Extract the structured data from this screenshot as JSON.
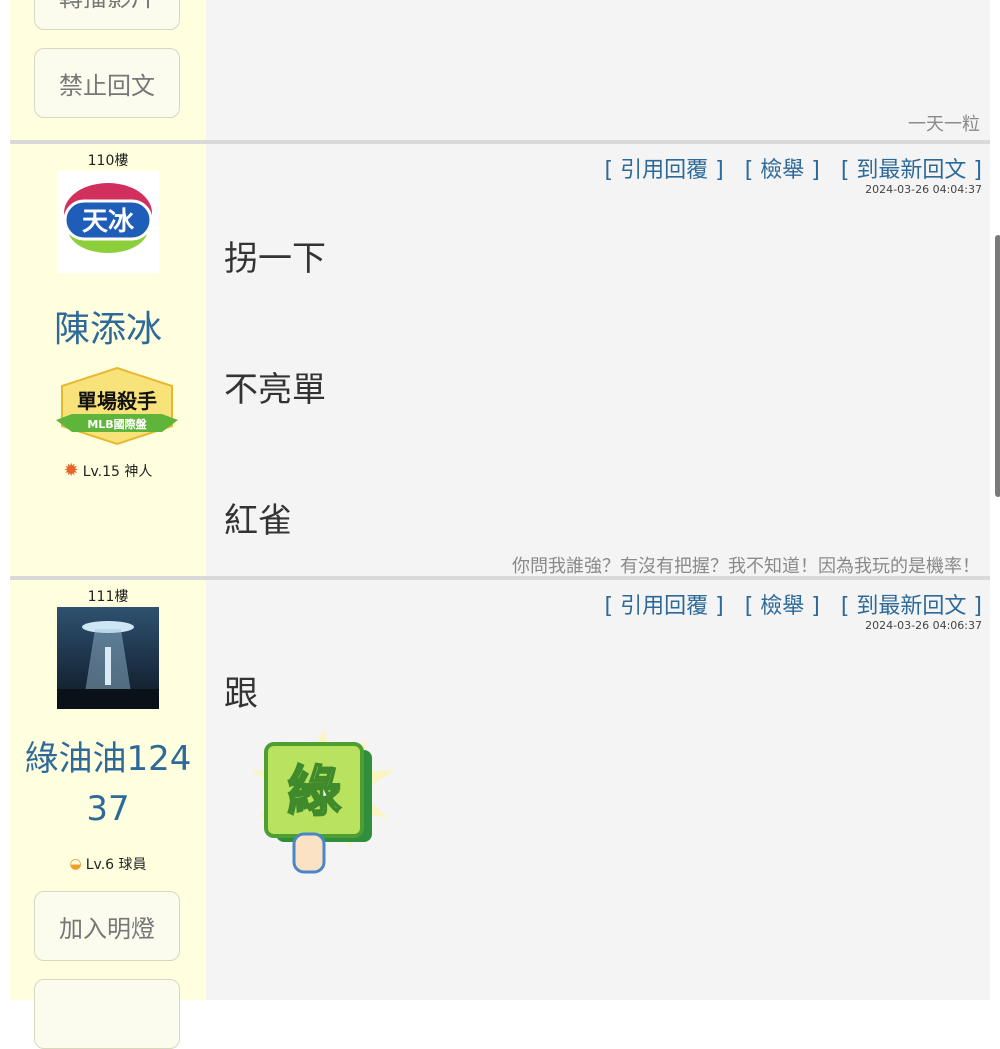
{
  "post_prev": {
    "buttons": [
      "轉播影片",
      "禁止回文"
    ],
    "signature": "一天一粒"
  },
  "post110": {
    "floor": "110樓",
    "avatar_text": "天冰",
    "username": "陳添冰",
    "badge_title": "單場殺手",
    "badge_sub": "MLB國際盤",
    "level": "Lv.15 神人",
    "actions": [
      "[ 引用回覆 ]",
      "[ 檢舉 ]",
      "[ 到最新回文 ]"
    ],
    "timestamp": "2024-03-26 04:04:37",
    "lines": [
      "拐一下",
      "不亮單",
      "紅雀"
    ],
    "signature": "你問我誰強？有沒有把握？我不知道！因為我玩的是機率！"
  },
  "post111": {
    "floor": "111樓",
    "username_line1": "綠油油124",
    "username_line2": "37",
    "level": "Lv.6 球員",
    "actions": [
      "[ 引用回覆 ]",
      "[ 檢舉 ]",
      "[ 到最新回文 ]"
    ],
    "timestamp": "2024-03-26 04:06:37",
    "line": "跟",
    "sticker_text": "綠",
    "buttons": [
      "加入明燈"
    ]
  },
  "colors": {
    "link": "#2d6a99",
    "sidebar": "#ffffe0",
    "content": "#f4f4f5"
  }
}
